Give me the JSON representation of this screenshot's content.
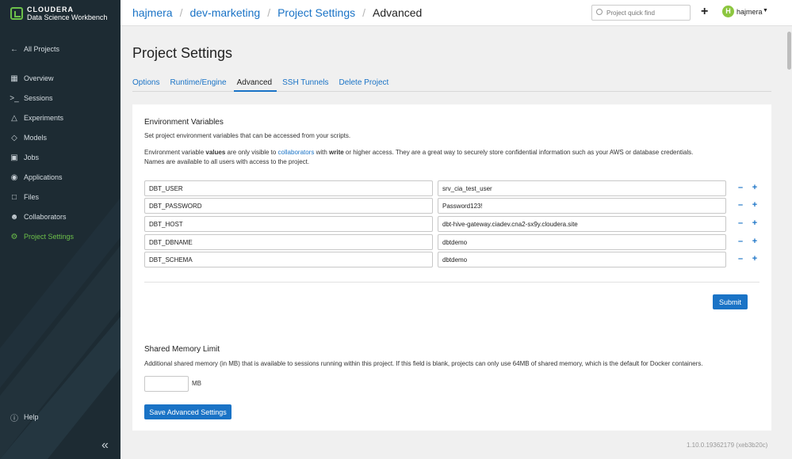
{
  "brand": {
    "name": "CLOUDERA",
    "product": "Data Science Workbench"
  },
  "sidebar": {
    "all_projects": "All Projects",
    "items": [
      {
        "label": "Overview",
        "icon": "dashboard-icon"
      },
      {
        "label": "Sessions",
        "icon": "terminal-icon"
      },
      {
        "label": "Experiments",
        "icon": "flask-icon"
      },
      {
        "label": "Models",
        "icon": "cube-icon"
      },
      {
        "label": "Jobs",
        "icon": "briefcase-icon"
      },
      {
        "label": "Applications",
        "icon": "application-icon"
      },
      {
        "label": "Files",
        "icon": "file-icon"
      },
      {
        "label": "Collaborators",
        "icon": "users-icon"
      },
      {
        "label": "Project Settings",
        "icon": "gear-icon",
        "active": true
      }
    ],
    "help": "Help"
  },
  "breadcrumb": [
    "hajmera",
    "dev-marketing",
    "Project Settings",
    "Advanced"
  ],
  "search": {
    "placeholder": "Project quick find"
  },
  "user": {
    "initial": "H",
    "name": "hajmera"
  },
  "page": {
    "title": "Project Settings",
    "tabs": [
      "Options",
      "Runtime/Engine",
      "Advanced",
      "SSH Tunnels",
      "Delete Project"
    ],
    "active_tab": "Advanced"
  },
  "env": {
    "title": "Environment Variables",
    "subtitle": "Set project environment variables that can be accessed from your scripts.",
    "desc_1": "Environment variable ",
    "desc_bold_1": "values",
    "desc_2": " are only visible to ",
    "desc_link": "collaborators",
    "desc_3": " with ",
    "desc_bold_2": "write",
    "desc_4": " or higher access. They are a great way to securely store confidential information such as your AWS or database credentials.",
    "desc_5": "Names are available to all users with access to the project.",
    "rows": [
      {
        "key": "DBT_USER",
        "value": "srv_cia_test_user"
      },
      {
        "key": "DBT_PASSWORD",
        "value": "Password123!"
      },
      {
        "key": "DBT_HOST",
        "value": "dbt-hive-gateway.ciadev.cna2-sx9y.cloudera.site"
      },
      {
        "key": "DBT_DBNAME",
        "value": "dbtdemo"
      },
      {
        "key": "DBT_SCHEMA",
        "value": "dbtdemo"
      }
    ],
    "submit": "Submit"
  },
  "shm": {
    "title": "Shared Memory Limit",
    "desc": "Additional shared memory (in MB) that is available to sessions running within this project. If this field is blank, projects can only use 64MB of shared memory, which is the default for Docker containers.",
    "value": "",
    "unit": "MB",
    "save": "Save Advanced Settings"
  },
  "version": "1.10.0.19362179 (xeb3b20c)",
  "colors": {
    "accent": "#1a73c6",
    "sidebar": "#1d2b33",
    "active": "#6cc04a"
  }
}
